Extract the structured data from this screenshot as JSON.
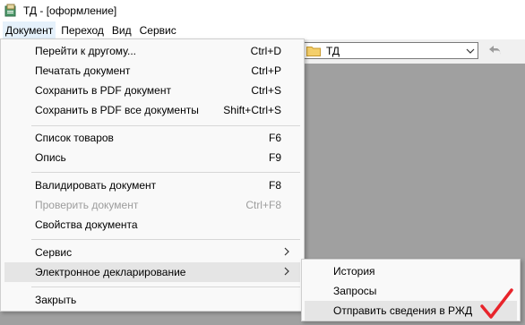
{
  "window": {
    "title": "ТД - [оформление]"
  },
  "menubar": {
    "items": [
      "Документ",
      "Переход",
      "Вид",
      "Сервис"
    ]
  },
  "toolbar": {
    "path_value": "ТД"
  },
  "menu": {
    "items": [
      {
        "label": "Перейти к другому...",
        "shortcut": "Ctrl+D"
      },
      {
        "label": "Печатать документ",
        "shortcut": "Ctrl+P"
      },
      {
        "label": "Сохранить в PDF документ",
        "shortcut": "Ctrl+S"
      },
      {
        "label": "Сохранить в PDF все документы",
        "shortcut": "Shift+Ctrl+S"
      },
      {
        "label": "Список товаров",
        "shortcut": "F6"
      },
      {
        "label": "Опись",
        "shortcut": "F9"
      },
      {
        "label": "Валидировать документ",
        "shortcut": "F8"
      },
      {
        "label": "Проверить документ",
        "shortcut": "Ctrl+F8"
      },
      {
        "label": "Свойства документа",
        "shortcut": ""
      },
      {
        "label": "Сервис",
        "shortcut": ""
      },
      {
        "label": "Электронное декларирование",
        "shortcut": ""
      },
      {
        "label": "Закрыть",
        "shortcut": ""
      }
    ]
  },
  "submenu": {
    "items": [
      "История",
      "Запросы",
      "Отправить сведения в РЖД"
    ]
  },
  "colors": {
    "checkmark": "#e8242b",
    "highlight": "#e5e5e5"
  }
}
